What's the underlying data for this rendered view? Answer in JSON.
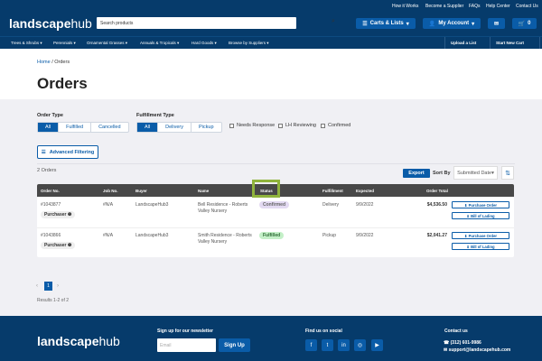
{
  "header": {
    "logo_bold": "landscape",
    "logo_light": "hub",
    "top_links": [
      "How it Works",
      "Become a Supplier",
      "FAQs",
      "Help Center",
      "Contact Us"
    ],
    "search_placeholder": "Search products",
    "carts_label": "Carts & Lists",
    "account_label": "My Account",
    "cart_count": "0"
  },
  "nav": {
    "items": [
      "Trees & Shrubs ▾",
      "Perennials ▾",
      "Ornamental Grasses ▾",
      "Annuals & Tropicals ▾",
      "Hard Goods ▾",
      "Browse by Suppliers ▾"
    ],
    "upload": "Upload a List",
    "new_cart": "Start New Cart"
  },
  "breadcrumb": {
    "home": "Home",
    "sep": " / ",
    "current": "Orders"
  },
  "title": "Orders",
  "filters": {
    "order_type_label": "Order Type",
    "order_types": [
      "All",
      "Fulfilled",
      "Cancelled"
    ],
    "fulfillment_label": "Fulfillment Type",
    "fulfillment_types": [
      "All",
      "Delivery",
      "Pickup"
    ],
    "checks": [
      "Needs Response",
      "LH Reviewing",
      "Confirmed"
    ],
    "advanced": "Advanced Filtering"
  },
  "list": {
    "count": "2 Orders",
    "export": "Export",
    "sort_by": "Sort By",
    "sort_value": "Submitted Date▾"
  },
  "table": {
    "headers": [
      "Order No.",
      "Job No.",
      "Buyer",
      "Name",
      "Status",
      "Fulfillment",
      "Expected",
      "Order Total"
    ],
    "rows": [
      {
        "order": "#1043877",
        "role": "Purchaser ❶",
        "job": "#N/A",
        "buyer": "LandscapeHub3",
        "name1": "Bell Residence - Roberts",
        "name2": "Valley Nursery",
        "status": "Confirmed",
        "fulfillment": "Delivery",
        "expected": "9/9/2022",
        "total": "$4,536.50"
      },
      {
        "order": "#1043866",
        "role": "Purchaser ❶",
        "job": "#N/A",
        "buyer": "LandscapeHub3",
        "name1": "Smith Residence - Roberts",
        "name2": "Valley Nursery",
        "status": "Fulfilled",
        "fulfillment": "Pickup",
        "expected": "9/9/2022",
        "total": "$2,041.27"
      }
    ],
    "po": "⬇ Purchase Order",
    "bol": "⬇ Bill of Lading"
  },
  "pagination": {
    "page": "1",
    "summary": "Results 1-2 of 2"
  },
  "footer": {
    "newsletter": "Sign up for our newsletter",
    "email_placeholder": "Email",
    "signup": "Sign Up",
    "social": "Find us on social",
    "contact": "Contact us",
    "phone": "(312) 601-9986",
    "email": "support@landscapehub.com"
  }
}
